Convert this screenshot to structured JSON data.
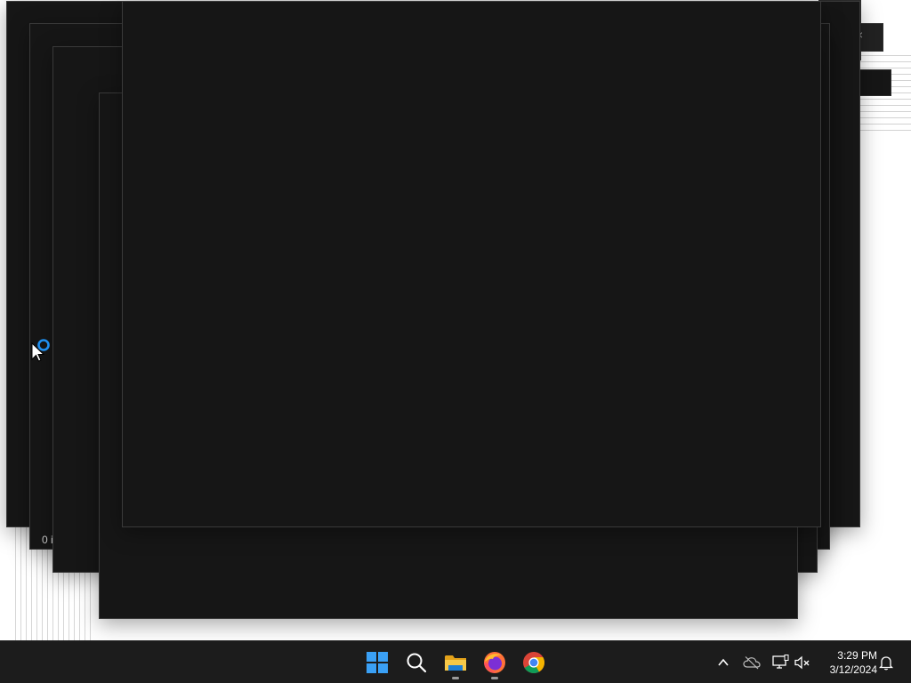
{
  "desktop": {
    "status_fragment": "0 i",
    "close_glyph": "×"
  },
  "taskbar": {
    "apps": [
      {
        "name": "Start"
      },
      {
        "name": "Search"
      },
      {
        "name": "File Explorer"
      },
      {
        "name": "Firefox"
      },
      {
        "name": "Google Chrome"
      }
    ],
    "clock": {
      "time": "3:29 PM",
      "date": "3/12/2024"
    }
  },
  "colors": {
    "window_bg": "#161616",
    "taskbar_bg": "#1c1c1c",
    "start_blue": "#3aa0f5",
    "busy_blue": "#1f8ff0"
  }
}
